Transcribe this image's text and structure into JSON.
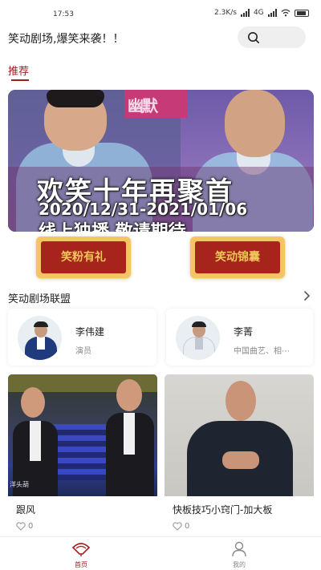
{
  "status_bar": {
    "time": "17:53",
    "network_speed": "2.3K/s",
    "network_type": "4G"
  },
  "header": {
    "slogan": "笑动剧场,爆笑来袭！！",
    "search_icon": "search-icon"
  },
  "tabs": {
    "recommend": "推荐"
  },
  "banner": {
    "title": "欢笑十年再聚首",
    "date_range": "2020/12/31-2021/01/06",
    "subtitle": "线上独播 敬请期待",
    "sign_text": "幽默"
  },
  "buttons": {
    "fans_gift": "笑粉有礼",
    "tips_bag": "笑动锦囊",
    "accent_color": "#a6241c",
    "gold_color": "#f6c463"
  },
  "alliance": {
    "title": "笑动剧场联盟",
    "more_icon": "chevron-right-icon",
    "members": [
      {
        "name": "李伟建",
        "desc": "演员"
      },
      {
        "name": "李菁",
        "desc": "中国曲艺、相⋯"
      }
    ]
  },
  "videos": [
    {
      "title": "跟风",
      "likes": "0",
      "thumb_caption": "洋头葫"
    },
    {
      "title": "快板技巧小窍门-加大板",
      "likes": "0"
    }
  ],
  "bottom_nav": {
    "home": "首页",
    "me": "我的",
    "active_color": "#a31d1d"
  }
}
